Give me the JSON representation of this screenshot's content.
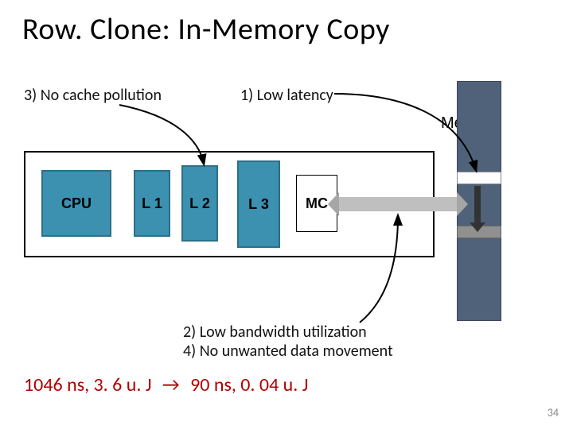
{
  "title_a": "Row",
  "title_b": "Clone: In-Memory Copy",
  "annotations": {
    "three": "3) No cache pollution",
    "one": "1) Low latency",
    "two_four_a": "2) Low bandwidth utilization",
    "two_four_b": "4) No unwanted data movement"
  },
  "memory_label": "Memory",
  "blocks": {
    "cpu": "CPU",
    "l1": "L 1",
    "l2": "L 2",
    "l3": "L 3",
    "mc": "MC"
  },
  "result": {
    "before": "1046 ns, 3. 6 u. J",
    "arrow": "→",
    "after": "90 ns, 0. 04 u. J"
  },
  "page_number": "34"
}
